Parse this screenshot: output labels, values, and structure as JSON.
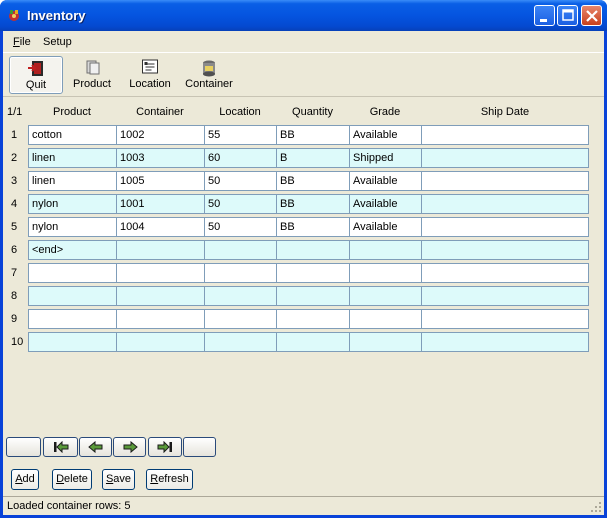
{
  "window": {
    "title": "Inventory"
  },
  "menu": [
    {
      "label": "File",
      "mnemonic": "F",
      "rest": "ile"
    },
    {
      "label": "Setup",
      "mnemonic": "",
      "rest": "Setup"
    }
  ],
  "toolbar": [
    {
      "label": "Quit",
      "icon": "exit-door-icon"
    },
    {
      "label": "Product",
      "icon": "product-icon"
    },
    {
      "label": "Location",
      "icon": "location-icon"
    },
    {
      "label": "Container",
      "icon": "container-icon"
    }
  ],
  "grid": {
    "page_indicator": "1/1",
    "columns": [
      "Product",
      "Container",
      "Location",
      "Quantity",
      "Grade",
      "Ship Date"
    ],
    "rows": [
      {
        "num": "1",
        "cells": [
          "cotton",
          "1002",
          "55",
          "BB",
          "Available",
          ""
        ]
      },
      {
        "num": "2",
        "cells": [
          "linen",
          "1003",
          "60",
          "B",
          "Shipped",
          ""
        ]
      },
      {
        "num": "3",
        "cells": [
          "linen",
          "1005",
          "50",
          "BB",
          "Available",
          ""
        ]
      },
      {
        "num": "4",
        "cells": [
          "nylon",
          "1001",
          "50",
          "BB",
          "Available",
          ""
        ]
      },
      {
        "num": "5",
        "cells": [
          "nylon",
          "1004",
          "50",
          "BB",
          "Available",
          ""
        ]
      },
      {
        "num": "6",
        "cells": [
          "<end>",
          "",
          "",
          "",
          "",
          ""
        ]
      },
      {
        "num": "7",
        "cells": [
          "",
          "",
          "",
          "",
          "",
          ""
        ]
      },
      {
        "num": "8",
        "cells": [
          "",
          "",
          "",
          "",
          "",
          ""
        ]
      },
      {
        "num": "9",
        "cells": [
          "",
          "",
          "",
          "",
          "",
          ""
        ]
      },
      {
        "num": "10",
        "cells": [
          "",
          "",
          "",
          "",
          "",
          ""
        ]
      }
    ]
  },
  "navigation": [
    {
      "name": "nav-blank-left",
      "icon": ""
    },
    {
      "name": "nav-first-button",
      "icon": "first-page-icon"
    },
    {
      "name": "nav-prev-button",
      "icon": "arrow-left-icon"
    },
    {
      "name": "nav-next-button",
      "icon": "arrow-right-icon"
    },
    {
      "name": "nav-last-button",
      "icon": "last-page-icon"
    },
    {
      "name": "nav-blank-right",
      "icon": ""
    }
  ],
  "actions": {
    "add": {
      "label": "Add",
      "mnemonic": "A",
      "rest": "dd"
    },
    "delete": {
      "label": "Delete",
      "mnemonic": "D",
      "rest": "elete"
    },
    "save": {
      "label": "Save",
      "mnemonic": "S",
      "rest": "ave"
    },
    "refresh": {
      "label": "Refresh",
      "mnemonic": "R",
      "rest": "efresh"
    }
  },
  "status": {
    "text": "Loaded container rows: 5"
  },
  "colors": {
    "title_bar": "#0554e0",
    "row_alt": "#ddfafa",
    "window_bg": "#ece9d8",
    "cell_border": "#7f9db9"
  }
}
